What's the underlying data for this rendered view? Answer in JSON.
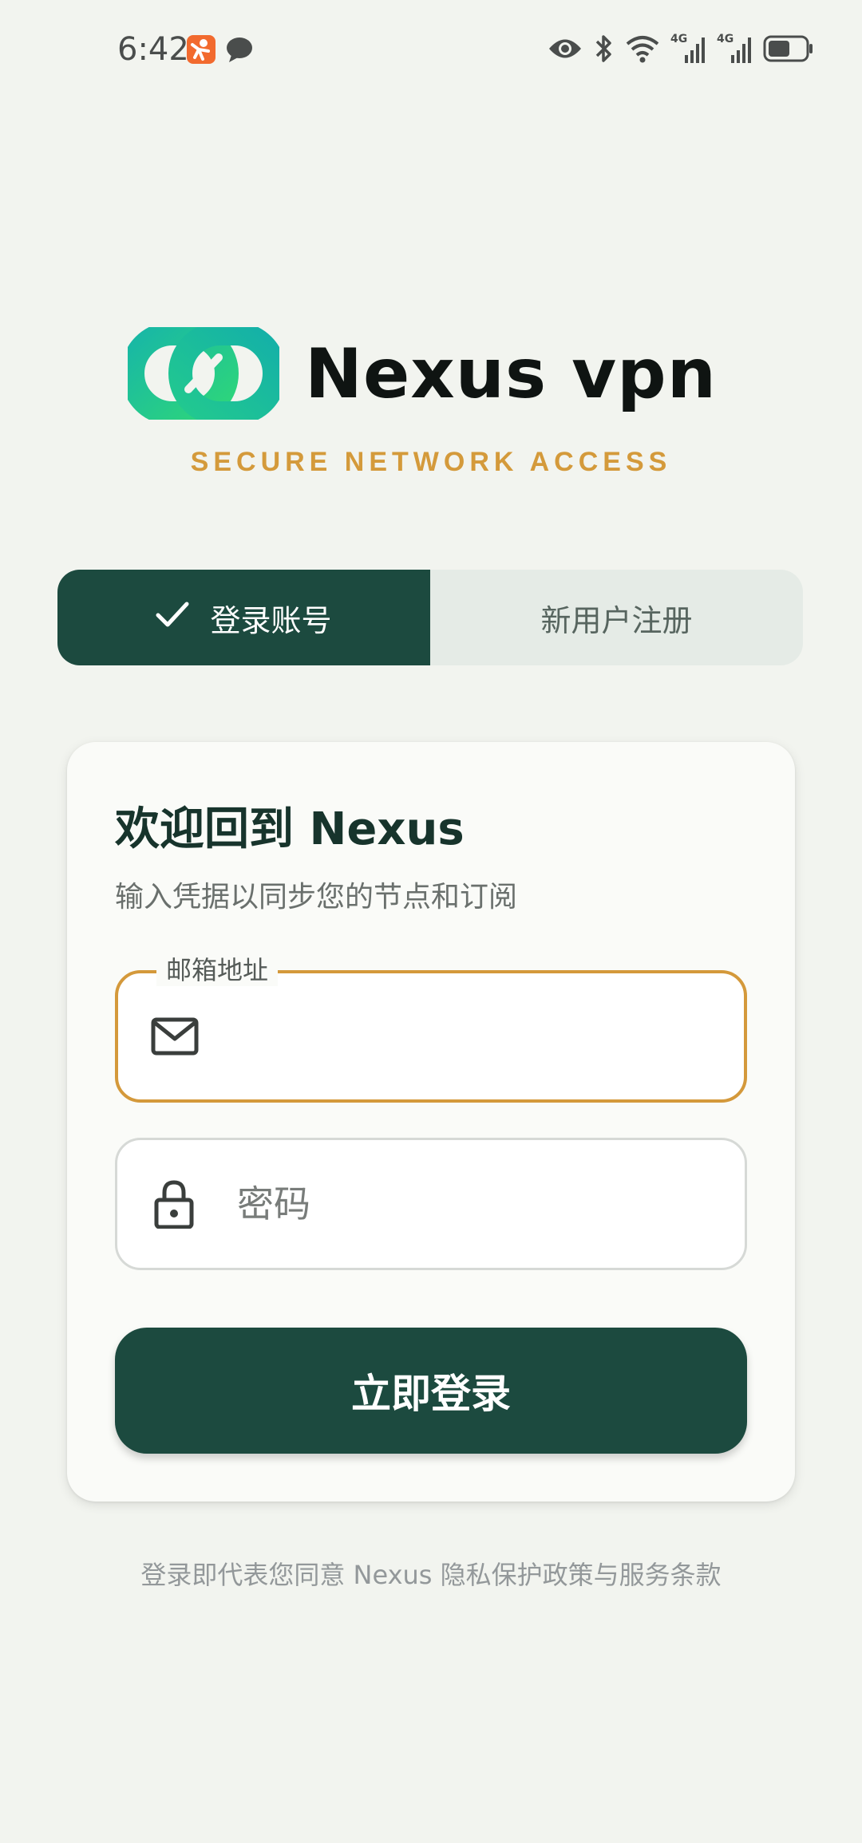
{
  "status_bar": {
    "time": "6:42",
    "icons": [
      "app-notification-icon",
      "message-bubble-icon",
      "eye-icon",
      "bluetooth-icon",
      "wifi-icon",
      "signal-4g-icon",
      "signal-4g-icon",
      "battery-icon"
    ],
    "signal_label_1": "4G",
    "signal_label_2": "4G"
  },
  "brand": {
    "name": "Nexus vpn",
    "tagline": "SECURE NETWORK ACCESS",
    "logo_icon": "chain-link-icon"
  },
  "tabs": [
    {
      "label": "登录账号",
      "active": true,
      "icon": "check-icon"
    },
    {
      "label": "新用户注册",
      "active": false
    }
  ],
  "card": {
    "title": "欢迎回到 Nexus",
    "subtitle": "输入凭据以同步您的节点和订阅",
    "email": {
      "label": "邮箱地址",
      "value": "",
      "placeholder": "",
      "icon": "mail-icon"
    },
    "password": {
      "value": "",
      "placeholder": "密码",
      "icon": "lock-icon"
    },
    "submit_label": "立即登录"
  },
  "footer": {
    "note": "登录即代表您同意 Nexus 隐私保护政策与服务条款"
  },
  "colors": {
    "background": "#f2f4ef",
    "primary": "#1c4a3f",
    "accent": "#d4993b",
    "card": "#fafbf8",
    "logo_gradient_start": "#18b7a6",
    "logo_gradient_end": "#2ed67a"
  }
}
